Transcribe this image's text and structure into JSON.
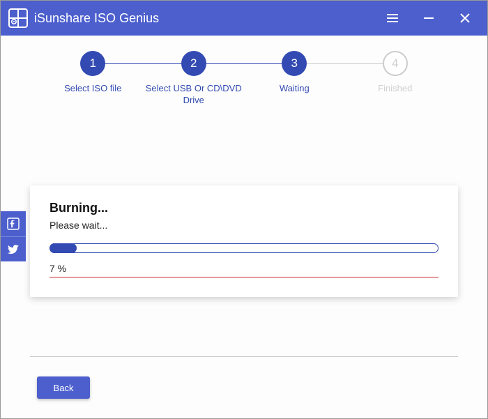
{
  "app_title": "iSunshare ISO Genius",
  "steps": [
    {
      "num": "1",
      "label": "Select ISO file",
      "active": true
    },
    {
      "num": "2",
      "label": "Select USB Or CD\\DVD Drive",
      "active": true
    },
    {
      "num": "3",
      "label": "Waiting",
      "active": true
    },
    {
      "num": "4",
      "label": "Finished",
      "active": false
    }
  ],
  "progress": {
    "title": "Burning...",
    "subtitle": "Please wait...",
    "percent_value": 7,
    "percent_text": "7 %"
  },
  "buttons": {
    "back": "Back"
  },
  "colors": {
    "primary": "#4c5fcd",
    "step": "#324ab2",
    "redline": "#d02424"
  }
}
